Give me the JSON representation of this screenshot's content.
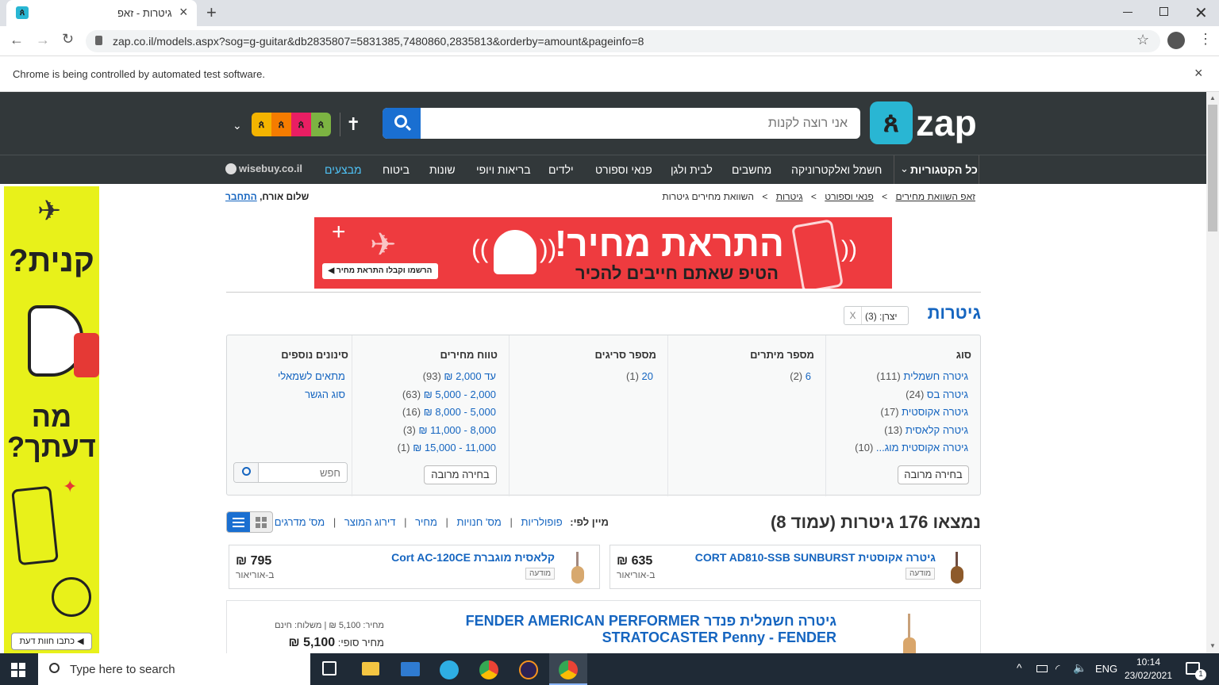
{
  "browser": {
    "tab_title": "גיטרות - זאפ",
    "new_tab": "+",
    "url": "zap.co.il/models.aspx?sog=g-guitar&db2835807=5831385,7480860,2835813&orderby=amount&pageinfo=8",
    "infobar_text": "Chrome is being controlled by automated test software.",
    "close": "×"
  },
  "header": {
    "logo_text": "zap",
    "search_placeholder": "אני רוצה לקנות"
  },
  "nav": {
    "all_categories": "כל הקטגוריות",
    "items": [
      "חשמל ואלקטרוניקה",
      "מחשבים",
      "לבית ולגן",
      "פנאי וספורט",
      "ילדים",
      "בריאות ויופי",
      "שונות",
      "ביטוח",
      "מבצעים"
    ],
    "wisebuy": "wisebuy.co.il"
  },
  "breadcrumb": {
    "items": [
      "זאפ השוואת מחירים",
      "פנאי וספורט",
      "גיטרות",
      "השוואת מחירים גיטרות"
    ],
    "sep": ">"
  },
  "greeting": {
    "hello": "שלום אורח,",
    "login": "התחבר"
  },
  "banner": {
    "title": "התראת מחיר!",
    "subtitle": "הטיפ שאתם חייבים להכיר",
    "cta": "הרשמו וקבלו התראת מחיר"
  },
  "side_ad": {
    "line1": "קנית?",
    "line2": "מה",
    "line3": "דעתך?",
    "cta": "כתבו חוות דעת"
  },
  "category": {
    "title": "גיטרות",
    "chip_label": "יצרן: (3)",
    "chip_close": "X"
  },
  "filters": {
    "type": {
      "title": "סוג",
      "items": [
        {
          "label": "גיטרה חשמלית",
          "count": "(111)"
        },
        {
          "label": "גיטרה בס",
          "count": "(24)"
        },
        {
          "label": "גיטרה אקוסטית",
          "count": "(17)"
        },
        {
          "label": "גיטרה קלאסית",
          "count": "(13)"
        },
        {
          "label": "גיטרה אקוסטית מוג...",
          "count": "(10)"
        }
      ],
      "button": "בחירה מרובה"
    },
    "strings": {
      "title": "מספר מיתרים",
      "items": [
        {
          "label": "6",
          "count": "(2)"
        }
      ]
    },
    "frets": {
      "title": "מספר סריגים",
      "items": [
        {
          "label": "20",
          "count": "(1)"
        }
      ]
    },
    "price": {
      "title": "טווח מחירים",
      "items": [
        {
          "label": "עד 2,000 ₪",
          "count": "(93)"
        },
        {
          "label": "2,000 - 5,000 ₪",
          "count": "(63)"
        },
        {
          "label": "5,000 - 8,000 ₪",
          "count": "(16)"
        },
        {
          "label": "8,000 - 11,000 ₪",
          "count": "(3)"
        },
        {
          "label": "11,000 - 15,000 ₪",
          "count": "(1)"
        }
      ],
      "button": "בחירה מרובה"
    },
    "more": {
      "title": "סינונים נוספים",
      "items": [
        "מתאים לשמאלי",
        "סוג הגשר"
      ],
      "search_placeholder": "חפש"
    }
  },
  "results": {
    "heading": "נמצאו 176 גיטרות (עמוד 8)",
    "sort_label": "מיין לפי:",
    "sort_options": [
      "פופולריות",
      "מס' חנויות",
      "מחיר",
      "דירוג המוצר",
      "מס' מדרגים"
    ],
    "sep": "|"
  },
  "ads": [
    {
      "title": "גיטרה אקוסטית CORT AD810-SSB SUNBURST",
      "badge": "מודעה",
      "price": "635 ₪",
      "store": "ב-אוריאור"
    },
    {
      "title": "קלאסית מוגברת Cort AC-120CE",
      "badge": "מודעה",
      "price": "795 ₪",
      "store": "ב-אוריאור"
    }
  ],
  "product": {
    "title_line1": "גיטרה חשמלית פנדר FENDER AMERICAN PERFORMER",
    "title_line2": "STRATOCASTER Penny - FENDER",
    "price_detail": "מחיר: 5,100 ₪ | משלוח: חינם",
    "final_label": "מחיר סופי:",
    "final_price": "5,100 ₪"
  },
  "taskbar": {
    "search_placeholder": "Type here to search",
    "lang": "ENG",
    "time": "10:14",
    "date": "23/02/2021",
    "notif_count": "1"
  },
  "colors": {
    "header_bg": "#32383a",
    "link": "#1565c0",
    "search_btn": "#1a6fd1",
    "banner_bg": "#ee3b3f",
    "ad_bg": "#e8f11a"
  }
}
